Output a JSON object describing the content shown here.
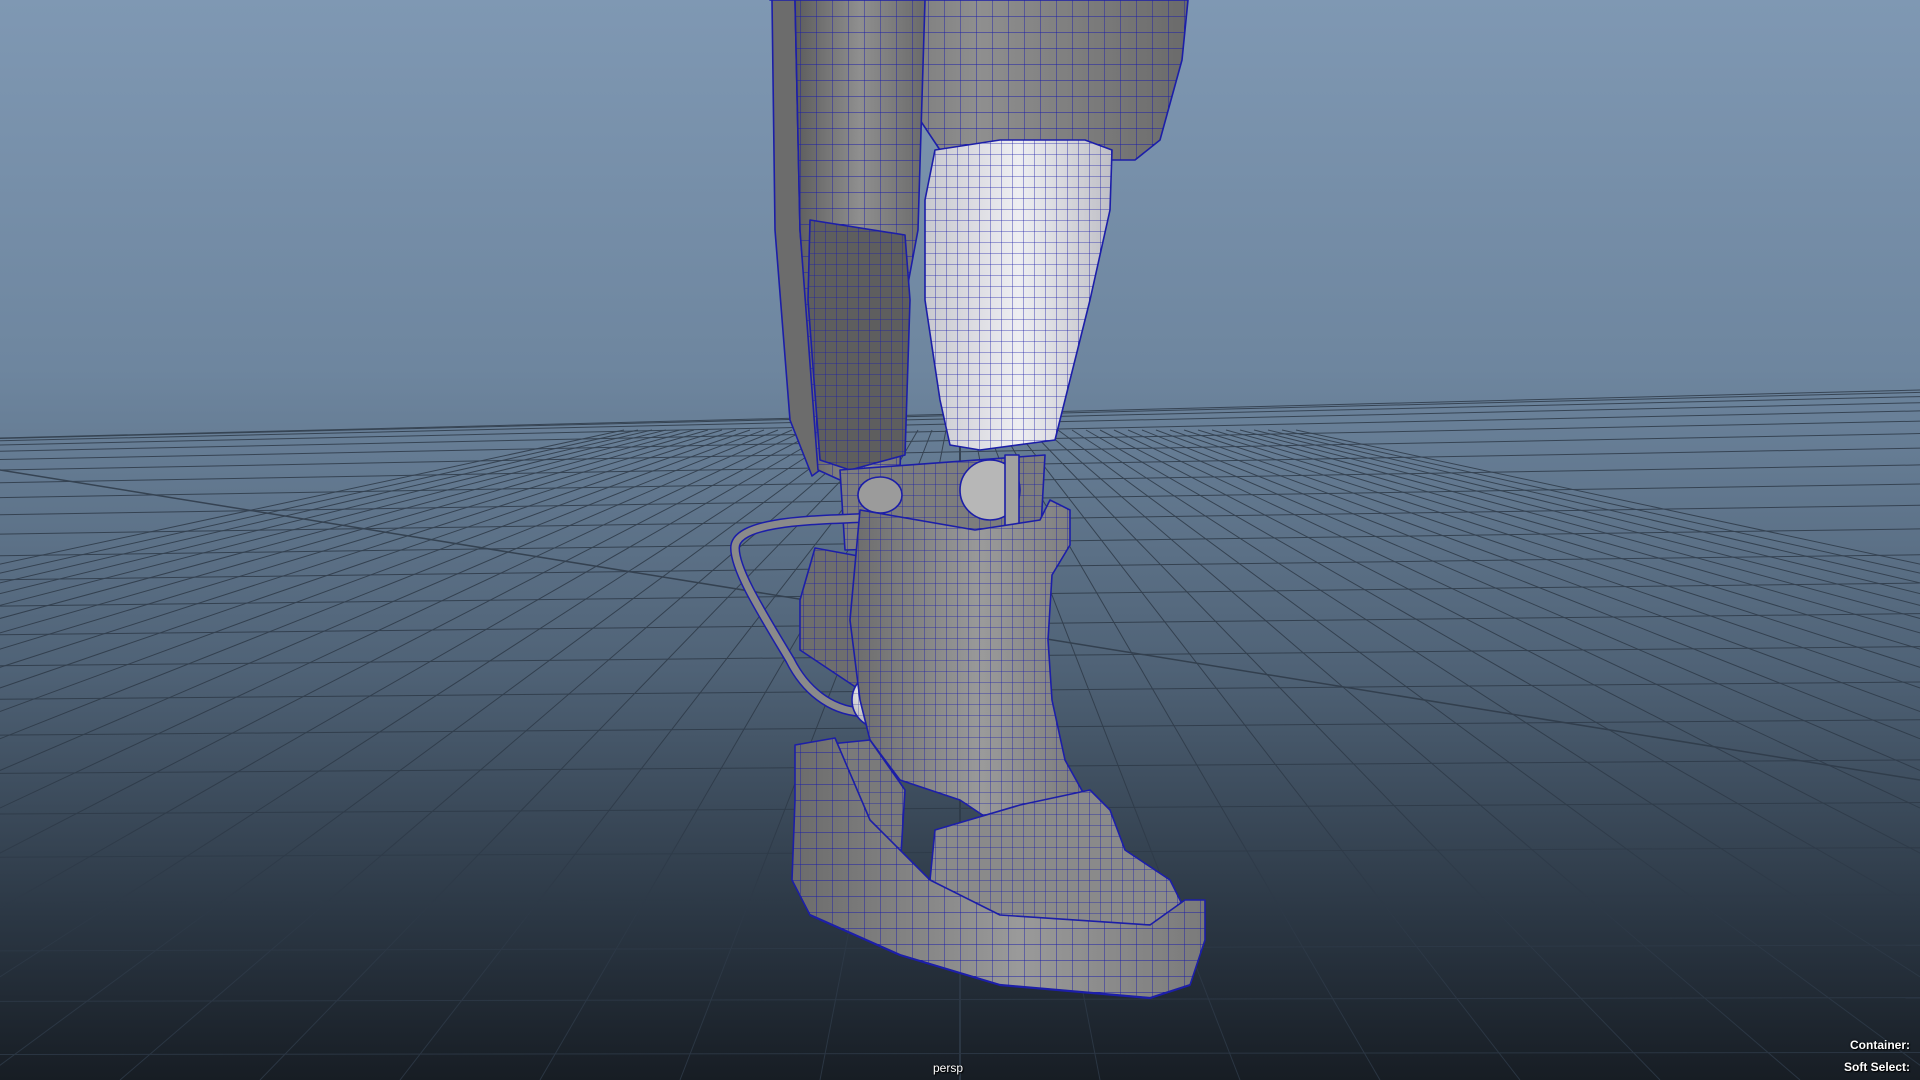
{
  "viewport": {
    "camera_label": "persp",
    "container_label": "Container:",
    "soft_select_label": "Soft Select:"
  },
  "scene": {
    "object": "robotic-leg-boot-mesh",
    "display_mode": "wireframe-on-shaded",
    "grid_visible": true
  },
  "colors": {
    "bg_top": "#7f98b3",
    "bg_bottom": "#171d24",
    "wireframe": "#1c1ea8",
    "surface": "#8c8c8c",
    "surface_light": "#d9d9de",
    "grid_line": "#2e3a48"
  }
}
